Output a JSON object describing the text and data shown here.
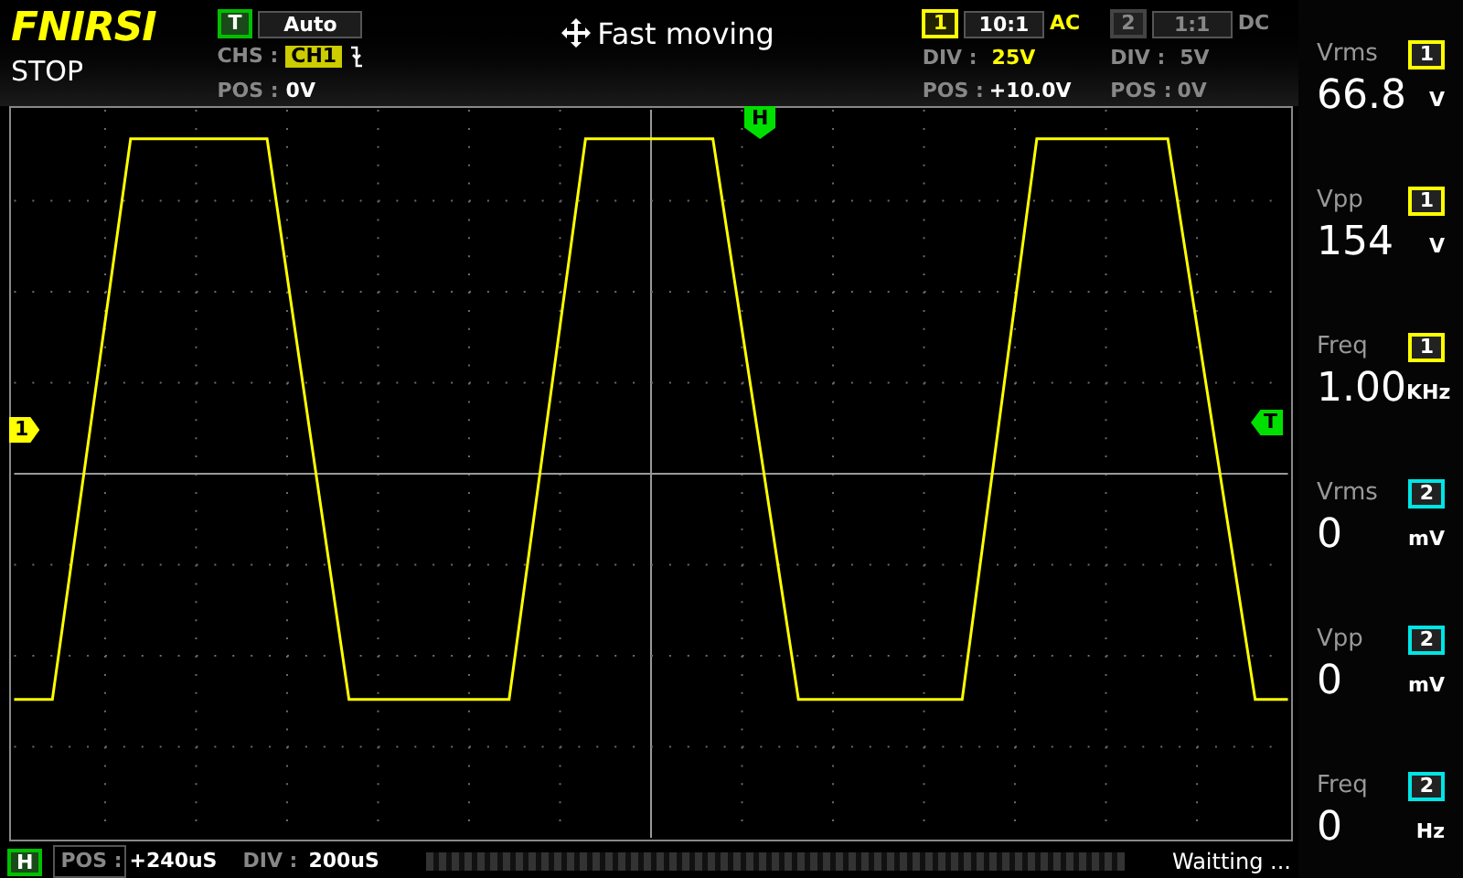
{
  "header": {
    "brand": "FNIRSI",
    "status": "STOP",
    "trigger": {
      "badge": "T",
      "mode": "Auto",
      "chs_label": "CHS :",
      "chs": "CH1",
      "pos_label": "POS :",
      "pos": "0V"
    },
    "move_mode": "Fast moving"
  },
  "channels": [
    {
      "badge": "1",
      "probe": "10:1",
      "coupling": "AC",
      "div_label": "DIV :",
      "div": "25V",
      "pos_label": "POS :",
      "pos": "+10.0V",
      "enabled": true
    },
    {
      "badge": "2",
      "probe": "1:1",
      "coupling": "DC",
      "div_label": "DIV :",
      "div": "5V",
      "pos_label": "POS :",
      "pos": "0V",
      "enabled": false
    }
  ],
  "markers": {
    "channel": "1",
    "trigger": "T",
    "horizontal": "H"
  },
  "measurements": [
    {
      "label": "Vrms",
      "channel": "1",
      "color": "#ffff00",
      "value": "66.8",
      "unit": "V"
    },
    {
      "label": "Vpp",
      "channel": "1",
      "color": "#ffff00",
      "value": "154",
      "unit": "V"
    },
    {
      "label": "Freq",
      "channel": "1",
      "color": "#ffff00",
      "value": "1.00",
      "unit": "KHz"
    },
    {
      "label": "Vrms",
      "channel": "2",
      "color": "#00e5e5",
      "value": "0",
      "unit": "mV"
    },
    {
      "label": "Vpp",
      "channel": "2",
      "color": "#00e5e5",
      "value": "0",
      "unit": "mV"
    },
    {
      "label": "Freq",
      "channel": "2",
      "color": "#00e5e5",
      "value": "0",
      "unit": "Hz"
    }
  ],
  "timebase": {
    "badge": "H",
    "pos_label": "POS :",
    "pos": "+240uS",
    "div_label": "DIV :",
    "div": "200uS"
  },
  "status_text": "Waitting ..."
}
